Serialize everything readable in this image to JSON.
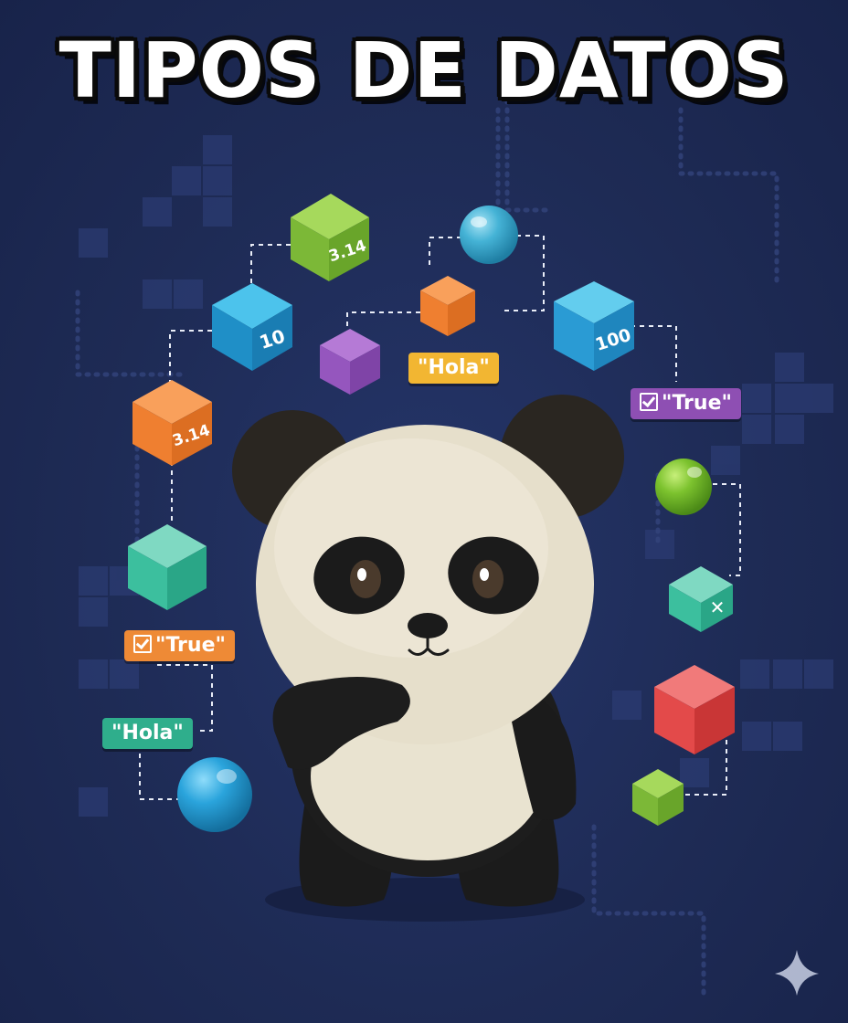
{
  "title": "TIPOS DE DATOS",
  "colors": {
    "background": "#1e2b55",
    "cube_green": "#8cc63f",
    "cube_blue": "#29a8d8",
    "cube_orange": "#f08a3a",
    "cube_purple": "#9b59b6",
    "cube_teal": "#3fbf9f",
    "cube_red": "#e34a4a",
    "tag_yellow": "#f2b632",
    "tag_purple": "#8e4fb3",
    "tag_orange": "#ee8a36",
    "tag_teal": "#2fae8c"
  },
  "cubes": [
    {
      "name": "cube-green-3-14",
      "label": "3.14"
    },
    {
      "name": "cube-blue-10",
      "label": "10"
    },
    {
      "name": "cube-orange-3-14",
      "label": "3.14"
    },
    {
      "name": "cube-blue-100",
      "label": "100"
    },
    {
      "name": "cube-teal-x",
      "label": "✕"
    }
  ],
  "tags": {
    "hola_center": "\"Hola\"",
    "true_right": "\"True\"",
    "true_left": "\"True\"",
    "hola_left": "\"Hola\""
  },
  "icons": [
    "sparkle-icon",
    "check-box-icon",
    "panda-mascot"
  ]
}
